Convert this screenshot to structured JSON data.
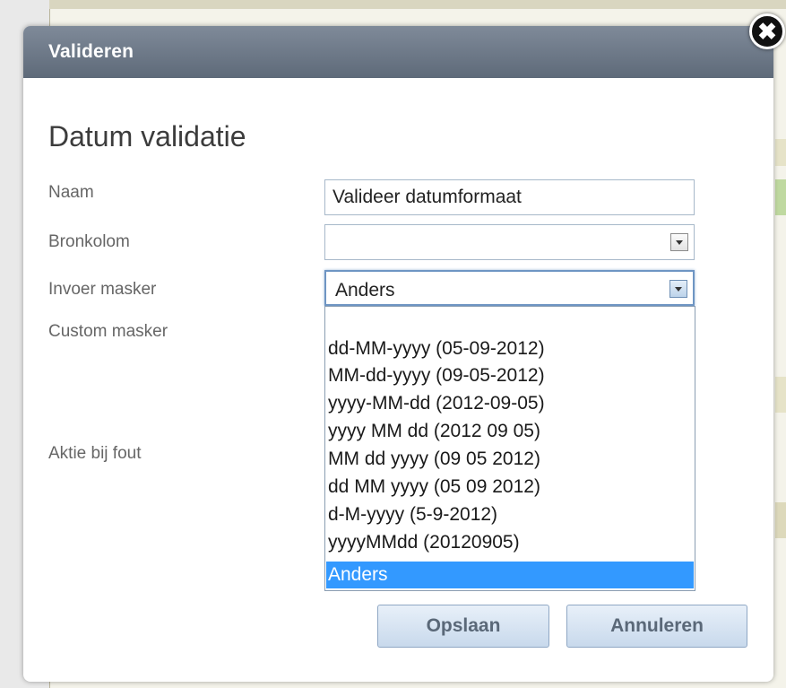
{
  "dialog": {
    "title": "Valideren",
    "close_symbol": "✖",
    "heading": "Datum validatie"
  },
  "form": {
    "naam": {
      "label": "Naam",
      "value": "Valideer datumformaat"
    },
    "bronkolom": {
      "label": "Bronkolom",
      "value": ""
    },
    "invoer_masker": {
      "label": "Invoer masker",
      "value": "Anders",
      "options": [
        "",
        "dd-MM-yyyy (05-09-2012)",
        "MM-dd-yyyy (09-05-2012)",
        "yyyy-MM-dd (2012-09-05)",
        "yyyy MM dd (2012 09 05)",
        "MM dd yyyy (09 05 2012)",
        "dd MM yyyy (05 09 2012)",
        "d-M-yyyy (5-9-2012)",
        "yyyyMMdd (20120905)",
        "Anders"
      ],
      "selected_index": 9
    },
    "custom_masker": {
      "label": "Custom masker"
    },
    "aktie_bij_fout": {
      "label": "Aktie bij fout"
    }
  },
  "buttons": {
    "save": "Opslaan",
    "cancel": "Annuleren"
  },
  "colors": {
    "header": "#6b7686",
    "selected_option": "#3399ff",
    "button_text": "#5a6878"
  }
}
